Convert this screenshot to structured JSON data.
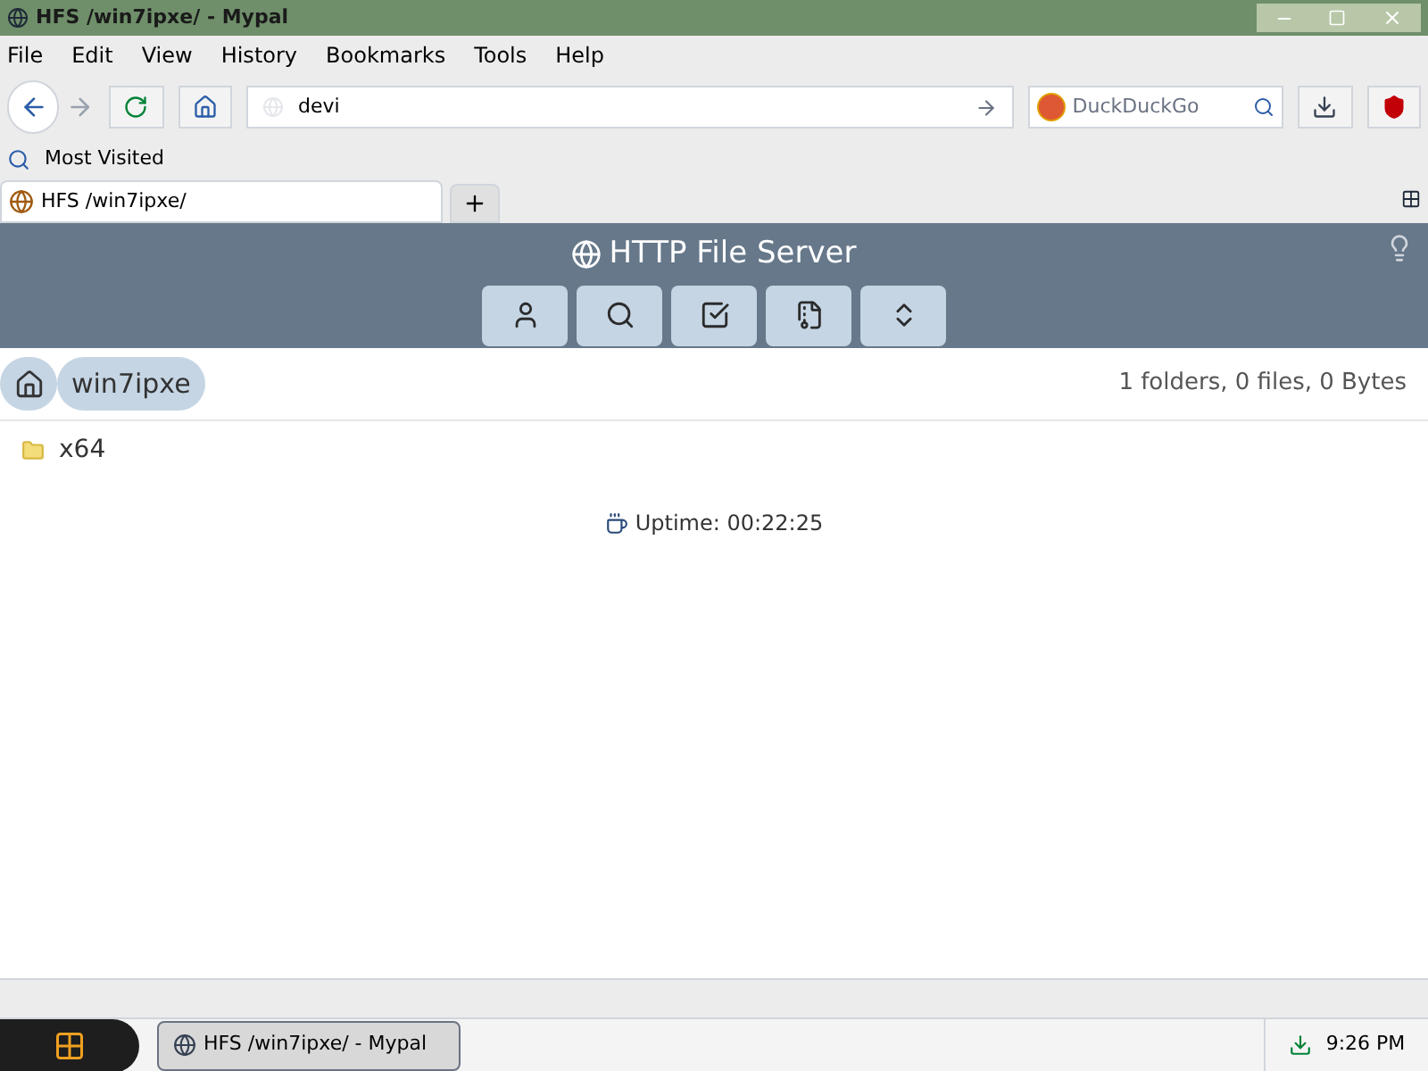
{
  "window": {
    "title": "HFS /win7ipxe/ - Mypal"
  },
  "menu": [
    "File",
    "Edit",
    "View",
    "History",
    "Bookmarks",
    "Tools",
    "Help"
  ],
  "address": {
    "value": "devi"
  },
  "search": {
    "placeholder": "DuckDuckGo"
  },
  "bookmarks": [
    "Most Visited"
  ],
  "tabs": [
    {
      "label": "HFS /win7ipxe/",
      "selected": true
    }
  ],
  "page": {
    "title": "HTTP File Server",
    "toolbar": [
      {
        "kind": "user"
      },
      {
        "kind": "search"
      },
      {
        "kind": "select"
      },
      {
        "kind": "archive"
      },
      {
        "kind": "sort"
      }
    ],
    "breadcrumb": [
      "win7ipxe"
    ],
    "summary": "1 folders, 0 files, 0 Bytes",
    "files": [
      {
        "name": "x64"
      }
    ],
    "uptime": "Uptime: 00:22:25"
  },
  "taskbar": {
    "items": [
      {
        "label": "HFS /win7ipxe/ - Mypal",
        "selected": true
      }
    ],
    "clock": "9:26 PM"
  }
}
